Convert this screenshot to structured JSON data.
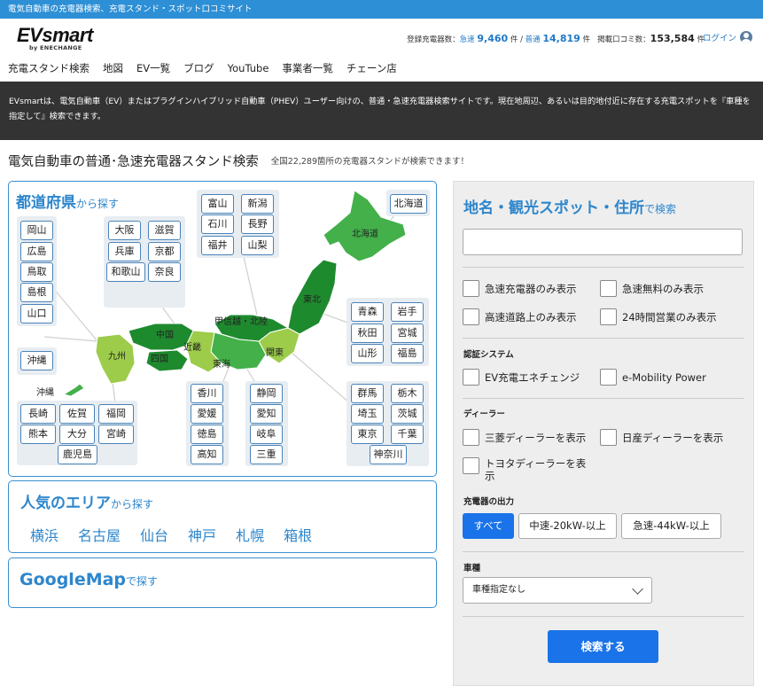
{
  "topbar": {
    "text": "電気自動車の充電器検索、充電スタンド・スポット口コミサイト"
  },
  "header": {
    "logo_main": "EVsmart",
    "logo_sub": "by ENECHANGE",
    "stats": {
      "label1": "登録充電器数：",
      "rapid_label": "急速",
      "rapid_count": "9,460",
      "unit1": "件 / ",
      "normal_label": "普通",
      "normal_count": "14,819",
      "unit2": "件",
      "reviews_label": "掲載口コミ数：",
      "reviews_count": "153,584",
      "unit3": "件"
    },
    "login_label": "ログイン"
  },
  "nav": [
    "充電スタンド検索",
    "地図",
    "EV一覧",
    "ブログ",
    "YouTube",
    "事業者一覧",
    "チェーン店"
  ],
  "banner": {
    "text": "EVsmartは、電気自動車（EV）またはプラグインハイブリッド自動車（PHEV）ユーザー向けの、普通・急速充電器検索サイトです。現在地周辺、あるいは目的地付近に存在する充電スポットを『車種を指定して』検索できます。"
  },
  "page": {
    "title": "電気自動車の普通･急速充電器スタンド検索",
    "subtitle": "全国22,289箇所の充電器スタンドが検索できます！"
  },
  "prefecture_search": {
    "heading": "都道府県",
    "heading_suffix": "から探す",
    "regions": [
      "北海道",
      "東北",
      "関東",
      "甲信越・北陸",
      "東海",
      "近畿",
      "中国",
      "四国",
      "九州",
      "沖縄"
    ],
    "hokkaido": [
      "北海道"
    ],
    "chugoku": [
      "岡山",
      "広島",
      "鳥取",
      "島根",
      "山口"
    ],
    "kinki": [
      "大阪",
      "滋賀",
      "兵庫",
      "京都",
      "和歌山",
      "奈良"
    ],
    "hokuriku": [
      "富山",
      "新潟",
      "石川",
      "長野",
      "福井",
      "山梨"
    ],
    "tohoku": [
      "青森",
      "岩手",
      "秋田",
      "宮城",
      "山形",
      "福島"
    ],
    "okinawa": [
      "沖縄"
    ],
    "shikoku": [
      "香川",
      "愛媛",
      "徳島",
      "高知"
    ],
    "tokai": [
      "静岡",
      "愛知",
      "岐阜",
      "三重"
    ],
    "kanto": [
      "群馬",
      "栃木",
      "埼玉",
      "茨城",
      "東京",
      "千葉",
      "神奈川"
    ],
    "kyushu": [
      "長崎",
      "佐賀",
      "福岡",
      "熊本",
      "大分",
      "宮崎",
      "鹿児島"
    ]
  },
  "popular": {
    "heading": "人気のエリア",
    "heading_suffix": "から探す",
    "cities": [
      "横浜",
      "名古屋",
      "仙台",
      "神戸",
      "札幌",
      "箱根"
    ]
  },
  "googlemap": {
    "heading": "GoogleMap",
    "heading_suffix": "で探す"
  },
  "search_panel": {
    "heading": "地名・観光スポット・住所",
    "heading_suffix": "で検索",
    "input_placeholder": "",
    "filters": [
      "急速充電器のみ表示",
      "急速無料のみ表示",
      "高速道路上のみ表示",
      "24時間営業のみ表示"
    ],
    "auth_label": "認証システム",
    "auth": [
      "EV充電エネチェンジ",
      "e-Mobility Power"
    ],
    "dealer_label": "ディーラー",
    "dealers": [
      "三菱ディーラーを表示",
      "日産ディーラーを表示",
      "トヨタディーラーを表示"
    ],
    "output_label": "充電器の出力",
    "output_options": [
      "すべて",
      "中速-20kW-以上",
      "急速-44kW-以上"
    ],
    "output_selected": "すべて",
    "vehicle_label": "車種",
    "vehicle_value": "車種指定なし",
    "search_button": "検索する"
  },
  "colors": {
    "accent": "#2d86cc",
    "button": "#1a73e8",
    "banner_bg": "#333333",
    "map_dark": "#1e8a2e",
    "map_mid": "#43b04a",
    "map_light": "#9ccc4a"
  }
}
